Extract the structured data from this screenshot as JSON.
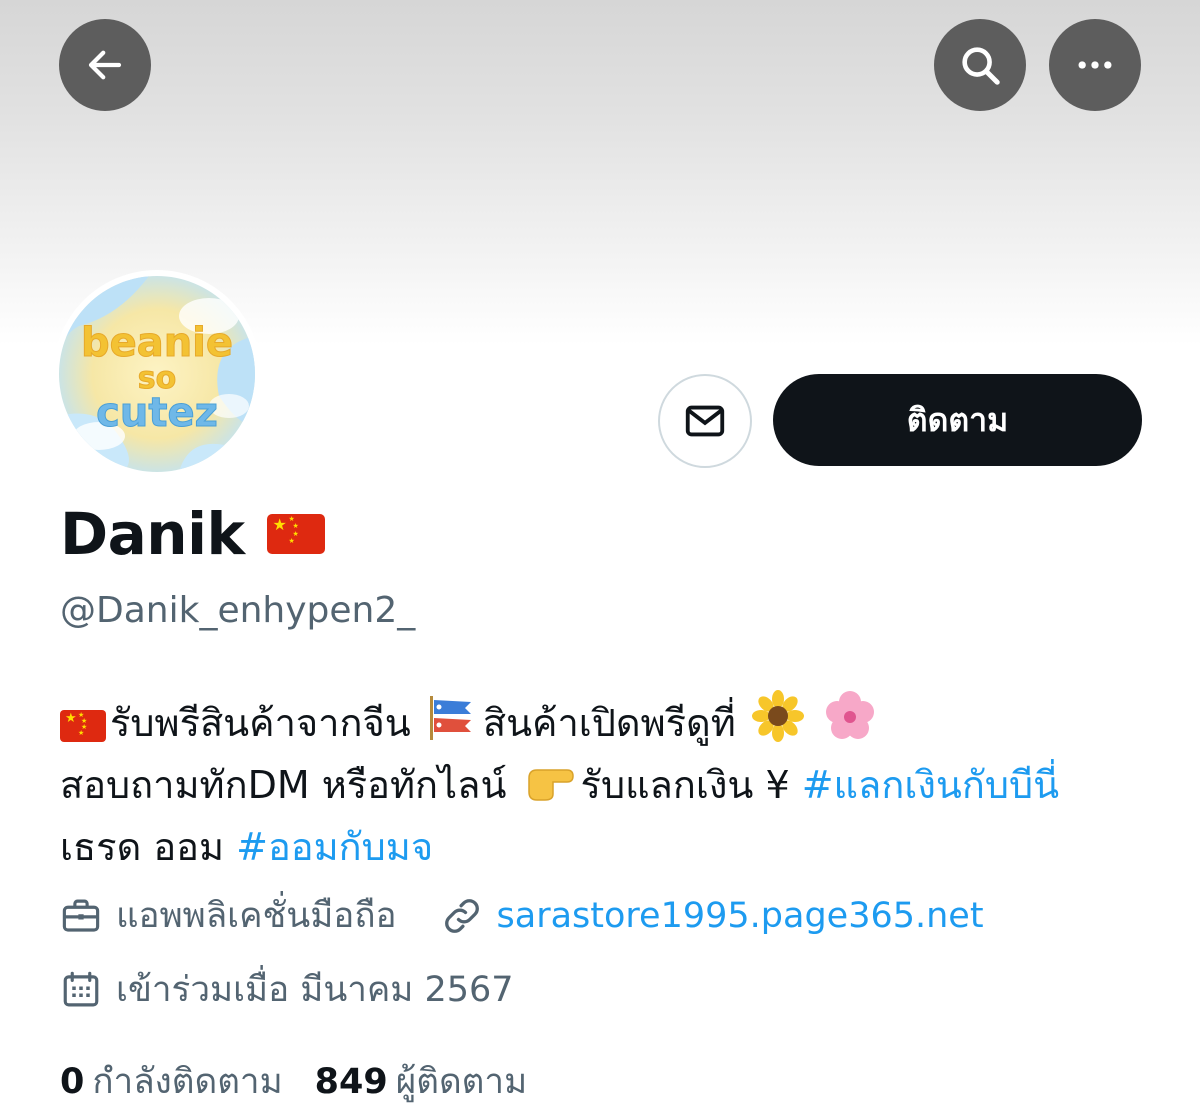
{
  "header": {
    "back_icon": "arrow-left-icon",
    "search_icon": "search-icon",
    "more_icon": "more-horizontal-icon"
  },
  "avatar": {
    "text_lines": [
      "beanie",
      "so",
      "cutez"
    ]
  },
  "actions": {
    "message_icon": "envelope-icon",
    "follow_label": "ติดตาม"
  },
  "profile": {
    "display_name": "Danik",
    "name_flag": "china-flag",
    "handle": "@Danik_enhypen2_"
  },
  "bio": {
    "part1": "รับพรีสินค้าจากจีน",
    "part2": "สินค้าเปิดพรีดูที่",
    "part3": "สอบถามทักDM หรือทักไลน์",
    "part4": "รับแลกเงิน ¥",
    "hashtag1": "#แลกเงินกับบีนี่",
    "part5": "เธรด ออม",
    "hashtag2": "#ออมกับมจ",
    "emojis": [
      "china-flag",
      "carp-streamer",
      "sunflower",
      "cherry-blossom",
      "pointing-right"
    ]
  },
  "meta": {
    "category": "แอพพลิเคชั่นมือถือ",
    "website": "sarastore1995.page365.net",
    "joined": "เข้าร่วมเมื่อ มีนาคม 2567"
  },
  "stats": {
    "following_count": "0",
    "following_label": "กำลังติดตาม",
    "followers_count": "849",
    "followers_label": "ผู้ติดตาม"
  },
  "colors": {
    "accent": "#1d9bf0",
    "text": "#0f1419",
    "secondary": "#536471",
    "button_dark": "#0f1419",
    "overlay_button": "#5d5d5d"
  }
}
